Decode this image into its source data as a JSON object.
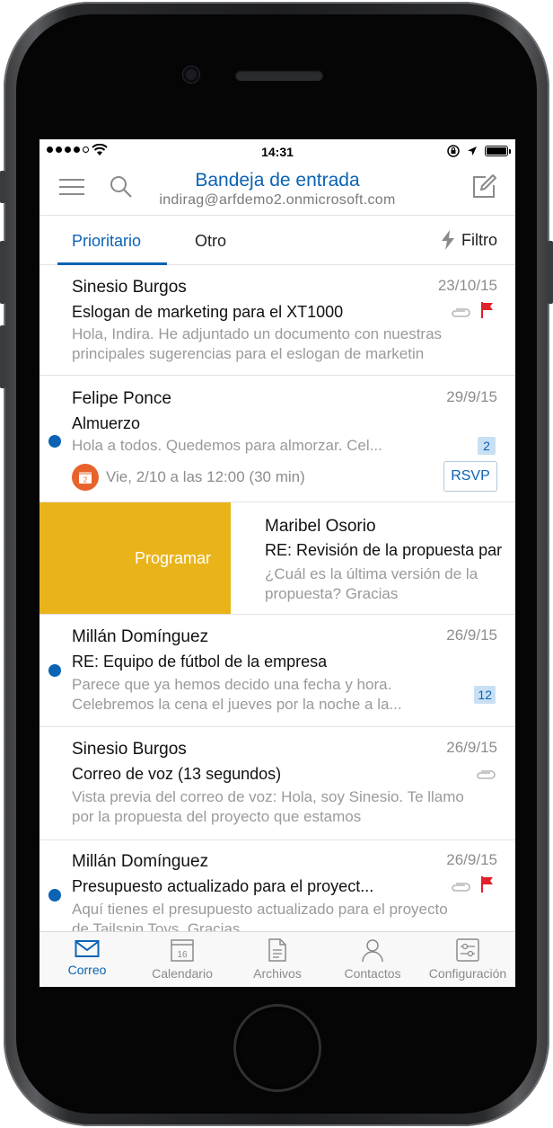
{
  "status_bar": {
    "time": "14:31"
  },
  "header": {
    "title": "Bandeja de entrada",
    "account": "indirag@arfdemo2.onmicrosoft.com"
  },
  "tabs": {
    "focused": "Prioritario",
    "other": "Otro",
    "filter": "Filtro"
  },
  "mails": [
    {
      "sender": "Sinesio Burgos",
      "subject": "Eslogan de marketing para el XT1000",
      "preview": "Hola, Indira. He adjuntado un documento con nuestras principales sugerencias para el eslogan de marketin",
      "date": "23/10/15",
      "unread": false,
      "attachment": true,
      "flagged": true
    },
    {
      "sender": "Felipe Ponce",
      "subject": "Almuerzo",
      "preview": "Hola a todos. Quedemos para almorzar. Cel...",
      "date": "29/9/15",
      "unread": true,
      "count": "2",
      "event_day": "2",
      "event_text": "Vie, 2/10 a las 12:00 (30 min)",
      "rsvp": "RSVP"
    },
    {
      "sender": "Millán Domínguez",
      "subject": "RE: Equipo de fútbol de la empresa",
      "preview": "Parece que ya hemos decido una fecha y hora. Celebremos la cena el jueves por la noche a la...",
      "date": "26/9/15",
      "unread": true,
      "count": "12"
    },
    {
      "sender": "Sinesio Burgos",
      "subject": "Correo de voz (13 segundos)",
      "preview": "Vista previa del correo de voz: Hola, soy Sinesio. Te llamo por la propuesta del proyecto que estamos",
      "date": "26/9/15",
      "unread": false,
      "attachment": true
    },
    {
      "sender": "Millán Domínguez",
      "subject": "Presupuesto actualizado para el proyect...",
      "preview": "Aquí tienes el presupuesto actualizado para el proyecto de Tailspin Toys. Gracias",
      "date": "26/9/15",
      "unread": true,
      "attachment": true,
      "flagged": true
    }
  ],
  "swiped_mail": {
    "action": "Programar",
    "sender": "Maribel Osorio",
    "subject": "RE: Revisión de la propuesta par",
    "preview": "¿Cuál es la última versión de la propuesta? Gracias"
  },
  "tabbar": {
    "mail": "Correo",
    "calendar": "Calendario",
    "calendar_day": "16",
    "files": "Archivos",
    "contacts": "Contactos",
    "settings": "Configuración"
  },
  "colors": {
    "accent": "#0a63b5",
    "schedule_action": "#e9b41a",
    "flag": "#e0202a",
    "event_icon": "#e8632c"
  }
}
